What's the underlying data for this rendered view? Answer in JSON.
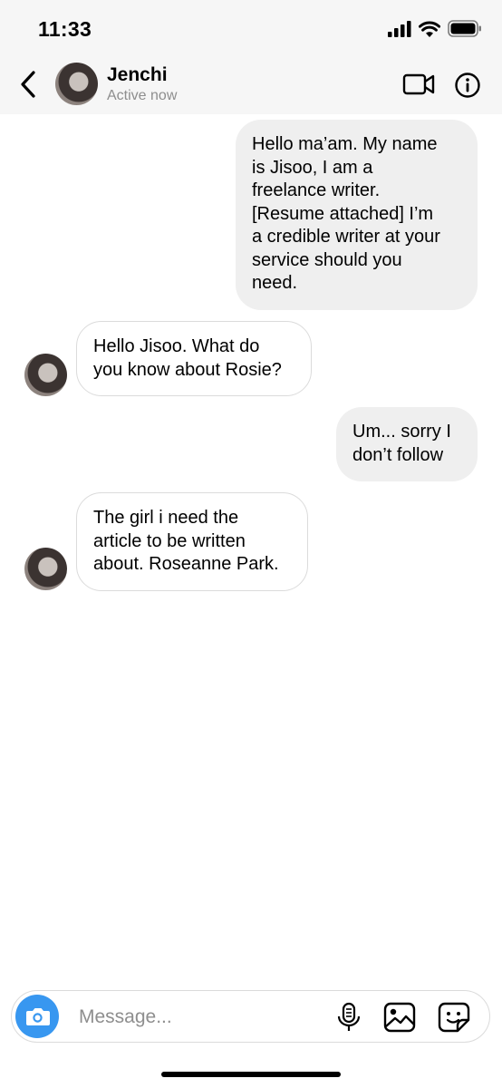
{
  "status_bar": {
    "time": "11:33",
    "icons": [
      "cellular-signal-icon",
      "wifi-icon",
      "battery-icon"
    ]
  },
  "header": {
    "back_icon": "chevron-left-icon",
    "contact_name": "Jenchi",
    "contact_status": "Active now",
    "video_icon": "video-camera-icon",
    "info_icon": "info-icon"
  },
  "messages": [
    {
      "direction": "outgoing",
      "text_lines": [
        "Hello ma’am. My name",
        "is Jisoo, I am a",
        "freelance writer.",
        "[Resume attached] I’m",
        "a credible writer at your",
        "service should you",
        "need."
      ]
    },
    {
      "direction": "incoming",
      "text_lines": [
        "Hello Jisoo. What do",
        "you know about Rosie?"
      ]
    },
    {
      "direction": "outgoing",
      "text_lines": [
        "Um... sorry I",
        "don’t follow"
      ]
    },
    {
      "direction": "incoming",
      "text_lines": [
        "The girl i need the",
        "article to be written",
        "about. Roseanne Park."
      ]
    }
  ],
  "composer": {
    "placeholder": "Message...",
    "value": "",
    "camera_icon": "camera-icon",
    "mic_icon": "microphone-icon",
    "gallery_icon": "image-gallery-icon",
    "sticker_icon": "sticker-icon"
  },
  "colors": {
    "header_background": "#f6f6f6",
    "outgoing_bubble": "#efefef",
    "incoming_bubble_border": "#dbdbdb",
    "camera_button": "#3897f0",
    "secondary_text": "#8e8e8e"
  }
}
